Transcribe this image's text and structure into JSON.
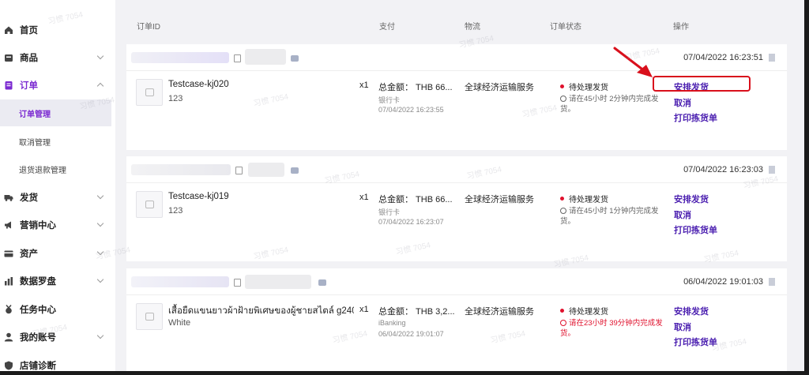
{
  "sidebar": {
    "items": [
      {
        "label": "首页",
        "icon": "home-icon",
        "expandable": false
      },
      {
        "label": "商品",
        "icon": "product-icon",
        "expandable": true
      },
      {
        "label": "订单",
        "icon": "order-icon",
        "expandable": true,
        "expanded": true,
        "active": true
      },
      {
        "label": "发货",
        "icon": "truck-icon",
        "expandable": true
      },
      {
        "label": "营销中心",
        "icon": "megaphone-icon",
        "expandable": true
      },
      {
        "label": "资产",
        "icon": "wallet-icon",
        "expandable": true
      },
      {
        "label": "数据罗盘",
        "icon": "chart-icon",
        "expandable": true
      },
      {
        "label": "任务中心",
        "icon": "medal-icon",
        "expandable": false
      },
      {
        "label": "我的账号",
        "icon": "user-icon",
        "expandable": true
      },
      {
        "label": "店铺诊断",
        "icon": "shield-icon",
        "expandable": false
      }
    ],
    "subitems": [
      {
        "label": "订单管理",
        "active": true
      },
      {
        "label": "取消管理",
        "active": false
      },
      {
        "label": "退货退款管理",
        "active": false
      }
    ]
  },
  "table": {
    "columns": {
      "order_id": "订单ID",
      "payment": "支付",
      "logistics": "物流",
      "order_status": "订单状态",
      "actions": "操作"
    }
  },
  "orders": [
    {
      "timestamp": "07/04/2022 16:23:51",
      "product_name": "Testcase-kj020",
      "sku": "123",
      "qty": "x1",
      "total": "总金额： THB 66...",
      "pay_method": "银行卡",
      "pay_time": "07/04/2022 16:23:55",
      "logistics": "全球经济运输服务",
      "status": "待处理发货",
      "deadline": "请在45小时 2分钟内完成发货。",
      "deadline_urgent": false,
      "actions": [
        "安排发货",
        "取消",
        "打印拣货单"
      ]
    },
    {
      "timestamp": "07/04/2022 16:23:03",
      "product_name": "Testcase-kj019",
      "sku": "123",
      "qty": "x1",
      "total": "总金额： THB 66...",
      "pay_method": "银行卡",
      "pay_time": "07/04/2022 16:23:07",
      "logistics": "全球经济运输服务",
      "status": "待处理发货",
      "deadline": "请在45小时 1分钟内完成发货。",
      "deadline_urgent": false,
      "actions": [
        "安排发货",
        "取消",
        "打印拣货单"
      ]
    },
    {
      "timestamp": "06/04/2022 19:01:03",
      "product_name": "เสื้อยืดแขนยาวผ้าฝ้ายพิเศษของผู้ชายสไตล์ g240...",
      "sku": "White",
      "qty": "x1",
      "total": "总金额： THB 3,2...",
      "pay_method": "iBanking",
      "pay_time": "06/04/2022 19:01:07",
      "logistics": "全球经济运输服务",
      "status": "待处理发货",
      "deadline": "请在23小时 39分钟内完成发货。",
      "deadline_urgent": true,
      "actions": [
        "安排发货",
        "取消",
        "打印拣货单"
      ]
    }
  ],
  "watermark": "习惯 7054",
  "colors": {
    "accent": "#7b2ad1",
    "action_link": "#4b1fb0",
    "status_red": "#e0112d",
    "highlight": "#d9101c"
  }
}
